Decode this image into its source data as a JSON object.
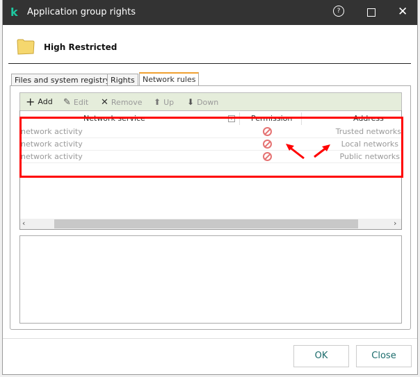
{
  "window": {
    "title": "Application group rights",
    "help_icon": "question-circle-icon",
    "maximize_icon": "square-icon",
    "close_icon": "x-icon"
  },
  "header": {
    "group_name": "High Restricted",
    "icon": "folder-icon"
  },
  "tabs": [
    {
      "label": "Files and system registry"
    },
    {
      "label": "Rights"
    },
    {
      "label": "Network rules",
      "active": true
    }
  ],
  "toolbar": {
    "add": "Add",
    "edit": "Edit",
    "remove": "Remove",
    "up": "Up",
    "down": "Down"
  },
  "table": {
    "columns": [
      "Network service",
      "Permission",
      "Address"
    ],
    "rows": [
      {
        "service": "network activity",
        "permission": "deny",
        "address": "Trusted networks"
      },
      {
        "service": "network activity",
        "permission": "deny",
        "address": "Local networks"
      },
      {
        "service": "network activity",
        "permission": "deny",
        "address": "Public networks"
      }
    ]
  },
  "footer": {
    "ok": "OK",
    "close": "Close"
  },
  "colors": {
    "highlight": "#ff0000",
    "accent": "#1ec8a0",
    "toolbar_bg": "#e5eddb"
  }
}
